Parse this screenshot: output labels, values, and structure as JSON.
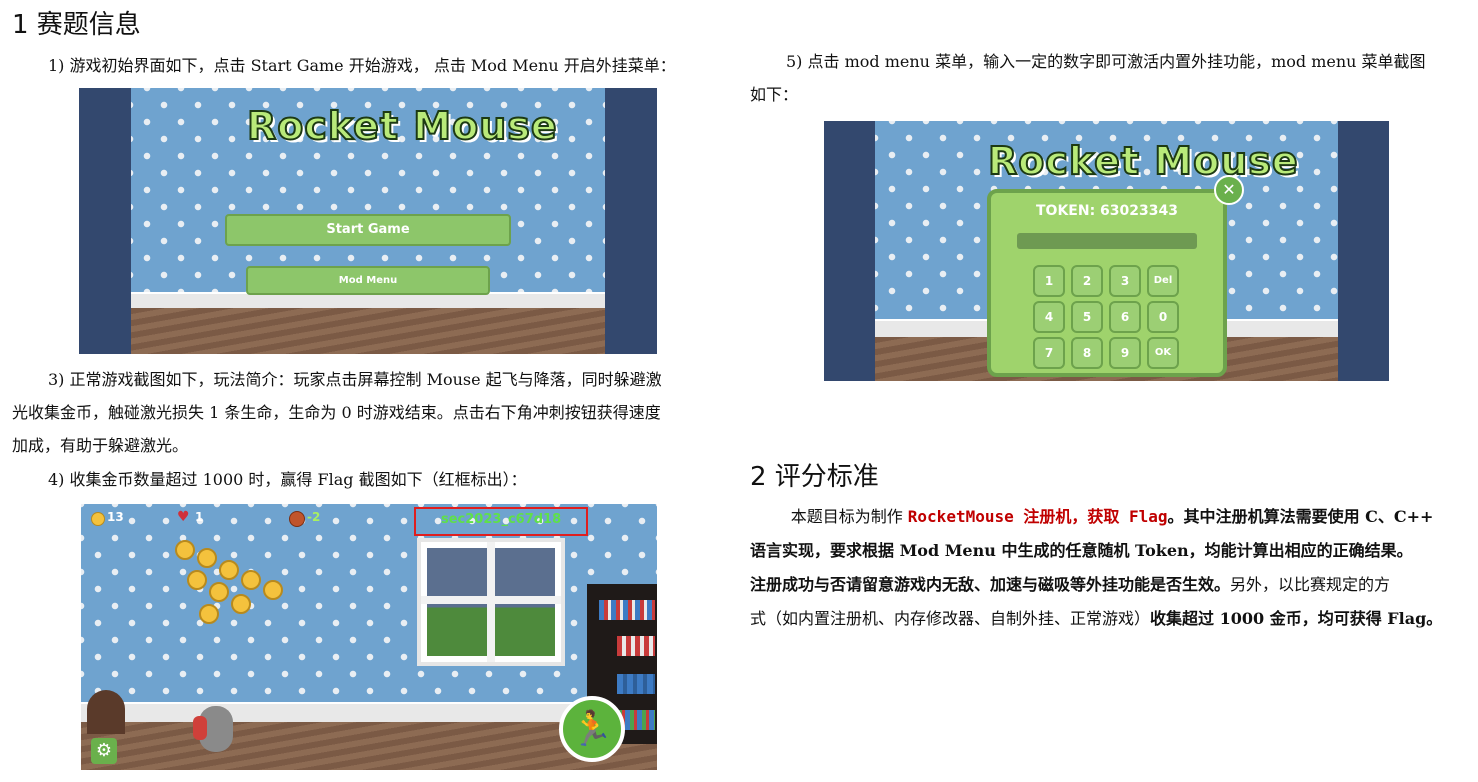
{
  "section1": {
    "title": "1 赛题信息"
  },
  "item1": "1)  游戏初始界面如下，点击 Start Game 开始游戏，  点击 Mod Menu 开启外挂菜单：",
  "menu_screen": {
    "logo": "Rocket Mouse",
    "start": "Start Game",
    "mod": "Mod Menu"
  },
  "item3": {
    "line1": "3)  正常游戏截图如下，玩法简介：玩家点击屏幕控制 Mouse 起飞与降落，同时躲避激",
    "line2": "光收集金币，触碰激光损失 1 条生命，生命为 0 时游戏结束。点击右下角冲刺按钮获得速度",
    "line3": "加成，有助于躲避激光。"
  },
  "item4": "4)  收集金币数量超过 1000 时，赢得 Flag 截图如下（红框标出）：",
  "game_screen": {
    "coins": "13",
    "lives": "1",
    "distance": "-2",
    "flag": "sec2023_c67d18"
  },
  "item5": {
    "line1": "5)  点击 mod menu 菜单，输入一定的数字即可激活内置外挂功能，mod menu 菜单截图",
    "line2": "如下："
  },
  "token_screen": {
    "logo": "Rocket Mouse",
    "token": "TOKEN: 63023343",
    "keys": [
      "1",
      "2",
      "3",
      "Del",
      "4",
      "5",
      "6",
      "0",
      "7",
      "8",
      "9",
      "OK"
    ]
  },
  "section2": {
    "title": "2 评分标准"
  },
  "criteria": {
    "a": "本题目标为制作 ",
    "b": "RocketMouse 注册机，获取 Flag",
    "c": "。其中",
    "d": "注册机算法需要使用 C、C++",
    "e": "语言实现，要求根据 Mod Menu 中生成的任意随机 Token，均能计算出相应的正确结果。",
    "f": "注册成功与否请留意游戏内无敌、加速与磁吸等外挂功能是否生效。",
    "g": "另外，以比赛规定的方",
    "h": "式（如内置注册机、内存修改器、自制外挂、正常游戏）",
    "i": "收集超过 1000 金币，均可获得 Flag。"
  }
}
